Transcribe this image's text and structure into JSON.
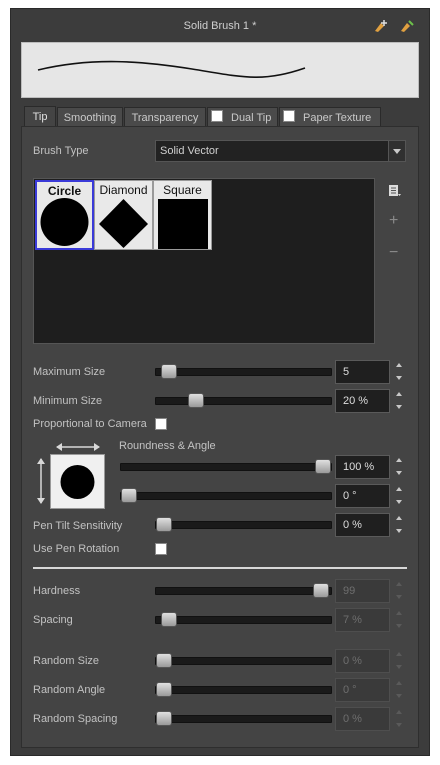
{
  "window": {
    "title": "Solid Brush 1 *"
  },
  "tabs": [
    {
      "label": "Tip"
    },
    {
      "label": "Smoothing"
    },
    {
      "label": "Transparency"
    },
    {
      "label": "Dual Tip"
    },
    {
      "label": "Paper Texture"
    }
  ],
  "brush_type": {
    "label": "Brush Type",
    "value": "Solid Vector"
  },
  "tips": [
    {
      "name": "Circle",
      "selected": true
    },
    {
      "name": "Diamond",
      "selected": false
    },
    {
      "name": "Square",
      "selected": false
    }
  ],
  "tip_actions": {
    "menu_icon": "list-menu-icon",
    "add": "+",
    "remove": "−"
  },
  "max_size": {
    "label": "Maximum Size",
    "value": "5",
    "level": 0.03
  },
  "min_size": {
    "label": "Minimum Size",
    "value": "20 %",
    "level": 0.2
  },
  "proportional": {
    "label": "Proportional to Camera",
    "checked": false
  },
  "roundness": {
    "label": "Roundness & Angle",
    "value": "100 %",
    "level": 1.0
  },
  "angle": {
    "value": "0 °",
    "level": 0.0
  },
  "pen_tilt": {
    "label": "Pen Tilt Sensitivity",
    "value": "0 %",
    "level": 0.0
  },
  "pen_rotation": {
    "label": "Use Pen Rotation",
    "checked": false
  },
  "hardness": {
    "label": "Hardness",
    "value": "99",
    "level": 0.99
  },
  "spacing": {
    "label": "Spacing",
    "value": "7 %",
    "level": 0.03
  },
  "random_size": {
    "label": "Random Size",
    "value": "0 %",
    "level": 0.0
  },
  "random_angle": {
    "label": "Random Angle",
    "value": "0 °",
    "level": 0.0
  },
  "random_spacing": {
    "label": "Random Spacing",
    "value": "0 %",
    "level": 0.0
  },
  "colors": {
    "panel": "#3c3c3c",
    "content": "#444444",
    "selection": "#3a3ad8"
  }
}
